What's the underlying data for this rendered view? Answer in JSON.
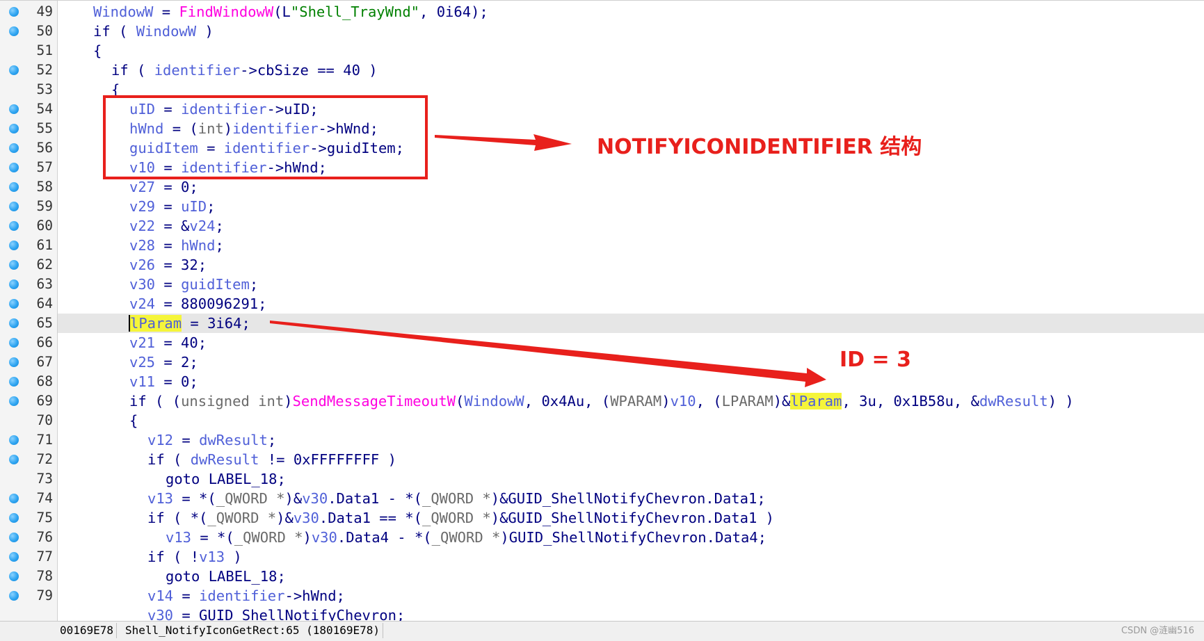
{
  "editor": {
    "lines": [
      {
        "n": "49",
        "bp": true,
        "indent": 0,
        "tokens": [
          [
            "v",
            "WindowW"
          ],
          [
            "k",
            " = "
          ],
          [
            "f",
            "FindWindowW"
          ],
          [
            "k",
            "(L"
          ],
          [
            "s",
            "\"Shell_TrayWnd\""
          ],
          [
            "k",
            ", 0i64);"
          ]
        ]
      },
      {
        "n": "50",
        "bp": true,
        "indent": 0,
        "tokens": [
          [
            "k",
            "if ( "
          ],
          [
            "v",
            "WindowW"
          ],
          [
            "k",
            " )"
          ]
        ]
      },
      {
        "n": "51",
        "bp": false,
        "indent": 0,
        "tokens": [
          [
            "k",
            "{"
          ]
        ]
      },
      {
        "n": "52",
        "bp": true,
        "indent": 1,
        "tokens": [
          [
            "k",
            "if ( "
          ],
          [
            "v",
            "identifier"
          ],
          [
            "k",
            "->cbSize == 40 )"
          ]
        ]
      },
      {
        "n": "53",
        "bp": false,
        "indent": 1,
        "tokens": [
          [
            "k",
            "{"
          ]
        ]
      },
      {
        "n": "54",
        "bp": true,
        "indent": 2,
        "tokens": [
          [
            "v",
            "uID"
          ],
          [
            "k",
            " = "
          ],
          [
            "v",
            "identifier"
          ],
          [
            "k",
            "->uID;"
          ]
        ]
      },
      {
        "n": "55",
        "bp": true,
        "indent": 2,
        "tokens": [
          [
            "v",
            "hWnd"
          ],
          [
            "k",
            " = ("
          ],
          [
            "c",
            "int"
          ],
          [
            "k",
            ")"
          ],
          [
            "v",
            "identifier"
          ],
          [
            "k",
            "->hWnd;"
          ]
        ]
      },
      {
        "n": "56",
        "bp": true,
        "indent": 2,
        "tokens": [
          [
            "v",
            "guidItem"
          ],
          [
            "k",
            " = "
          ],
          [
            "v",
            "identifier"
          ],
          [
            "k",
            "->guidItem;"
          ]
        ]
      },
      {
        "n": "57",
        "bp": true,
        "indent": 2,
        "tokens": [
          [
            "v",
            "v10"
          ],
          [
            "k",
            " = "
          ],
          [
            "v",
            "identifier"
          ],
          [
            "k",
            "->hWnd;"
          ]
        ]
      },
      {
        "n": "58",
        "bp": true,
        "indent": 2,
        "tokens": [
          [
            "v",
            "v27"
          ],
          [
            "k",
            " = 0;"
          ]
        ]
      },
      {
        "n": "59",
        "bp": true,
        "indent": 2,
        "tokens": [
          [
            "v",
            "v29"
          ],
          [
            "k",
            " = "
          ],
          [
            "v",
            "uID"
          ],
          [
            "k",
            ";"
          ]
        ]
      },
      {
        "n": "60",
        "bp": true,
        "indent": 2,
        "tokens": [
          [
            "v",
            "v22"
          ],
          [
            "k",
            " = &"
          ],
          [
            "v",
            "v24"
          ],
          [
            "k",
            ";"
          ]
        ]
      },
      {
        "n": "61",
        "bp": true,
        "indent": 2,
        "tokens": [
          [
            "v",
            "v28"
          ],
          [
            "k",
            " = "
          ],
          [
            "v",
            "hWnd"
          ],
          [
            "k",
            ";"
          ]
        ]
      },
      {
        "n": "62",
        "bp": true,
        "indent": 2,
        "tokens": [
          [
            "v",
            "v26"
          ],
          [
            "k",
            " = 32;"
          ]
        ]
      },
      {
        "n": "63",
        "bp": true,
        "indent": 2,
        "tokens": [
          [
            "v",
            "v30"
          ],
          [
            "k",
            " = "
          ],
          [
            "v",
            "guidItem"
          ],
          [
            "k",
            ";"
          ]
        ]
      },
      {
        "n": "64",
        "bp": true,
        "indent": 2,
        "tokens": [
          [
            "v",
            "v24"
          ],
          [
            "k",
            " = 880096291;"
          ]
        ]
      },
      {
        "n": "65",
        "bp": true,
        "indent": 2,
        "current": true,
        "tokens": [
          [
            "vcur",
            "l"
          ],
          [
            "vhi",
            "Param"
          ],
          [
            "k",
            " = 3i64;"
          ]
        ]
      },
      {
        "n": "66",
        "bp": true,
        "indent": 2,
        "tokens": [
          [
            "v",
            "v21"
          ],
          [
            "k",
            " = 40;"
          ]
        ]
      },
      {
        "n": "67",
        "bp": true,
        "indent": 2,
        "tokens": [
          [
            "v",
            "v25"
          ],
          [
            "k",
            " = 2;"
          ]
        ]
      },
      {
        "n": "68",
        "bp": true,
        "indent": 2,
        "tokens": [
          [
            "v",
            "v11"
          ],
          [
            "k",
            " = 0;"
          ]
        ]
      },
      {
        "n": "69",
        "bp": true,
        "indent": 2,
        "tokens": [
          [
            "k",
            "if ( ("
          ],
          [
            "c",
            "unsigned int"
          ],
          [
            "k",
            ")"
          ],
          [
            "f",
            "SendMessageTimeoutW"
          ],
          [
            "k",
            "("
          ],
          [
            "v",
            "WindowW"
          ],
          [
            "k",
            ", 0x4Au, ("
          ],
          [
            "c",
            "WPARAM"
          ],
          [
            "k",
            ")"
          ],
          [
            "v",
            "v10"
          ],
          [
            "k",
            ", ("
          ],
          [
            "c",
            "LPARAM"
          ],
          [
            "k",
            ")&"
          ],
          [
            "vhi",
            "lParam"
          ],
          [
            "k",
            ", 3u, 0x1B58u, &"
          ],
          [
            "v",
            "dwResult"
          ],
          [
            "k",
            ") )"
          ]
        ]
      },
      {
        "n": "70",
        "bp": false,
        "indent": 2,
        "tokens": [
          [
            "k",
            "{"
          ]
        ]
      },
      {
        "n": "71",
        "bp": true,
        "indent": 3,
        "tokens": [
          [
            "v",
            "v12"
          ],
          [
            "k",
            " = "
          ],
          [
            "v",
            "dwResult"
          ],
          [
            "k",
            ";"
          ]
        ]
      },
      {
        "n": "72",
        "bp": true,
        "indent": 3,
        "tokens": [
          [
            "k",
            "if ( "
          ],
          [
            "v",
            "dwResult"
          ],
          [
            "k",
            " != 0xFFFFFFFF )"
          ]
        ]
      },
      {
        "n": "73",
        "bp": false,
        "indent": 4,
        "tokens": [
          [
            "k",
            "goto LABEL_18;"
          ]
        ]
      },
      {
        "n": "74",
        "bp": true,
        "indent": 3,
        "tokens": [
          [
            "v",
            "v13"
          ],
          [
            "k",
            " = *("
          ],
          [
            "c",
            "_QWORD *"
          ],
          [
            "k",
            ")&"
          ],
          [
            "v",
            "v30"
          ],
          [
            "k",
            ".Data1 - *("
          ],
          [
            "c",
            "_QWORD *"
          ],
          [
            "k",
            ")&GUID_ShellNotifyChevron.Data1;"
          ]
        ]
      },
      {
        "n": "75",
        "bp": true,
        "indent": 3,
        "tokens": [
          [
            "k",
            "if ( *("
          ],
          [
            "c",
            "_QWORD *"
          ],
          [
            "k",
            ")&"
          ],
          [
            "v",
            "v30"
          ],
          [
            "k",
            ".Data1 == *("
          ],
          [
            "c",
            "_QWORD *"
          ],
          [
            "k",
            ")&GUID_ShellNotifyChevron.Data1 )"
          ]
        ]
      },
      {
        "n": "76",
        "bp": true,
        "indent": 4,
        "tokens": [
          [
            "v",
            "v13"
          ],
          [
            "k",
            " = *("
          ],
          [
            "c",
            "_QWORD *"
          ],
          [
            "k",
            ")"
          ],
          [
            "v",
            "v30"
          ],
          [
            "k",
            ".Data4 - *("
          ],
          [
            "c",
            "_QWORD *"
          ],
          [
            "k",
            ")GUID_ShellNotifyChevron.Data4;"
          ]
        ]
      },
      {
        "n": "77",
        "bp": true,
        "indent": 3,
        "tokens": [
          [
            "k",
            "if ( !"
          ],
          [
            "v",
            "v13"
          ],
          [
            "k",
            " )"
          ]
        ]
      },
      {
        "n": "78",
        "bp": true,
        "indent": 4,
        "tokens": [
          [
            "k",
            "goto LABEL_18;"
          ]
        ]
      },
      {
        "n": "79",
        "bp": true,
        "indent": 3,
        "tokens": [
          [
            "v",
            "v14"
          ],
          [
            "k",
            " = "
          ],
          [
            "v",
            "identifier"
          ],
          [
            "k",
            "->hWnd;"
          ]
        ]
      },
      {
        "n": "",
        "bp": false,
        "indent": 3,
        "tokens": [
          [
            "v",
            "v30"
          ],
          [
            "k",
            " = GUID_ShellNotifyChevron;"
          ]
        ]
      }
    ]
  },
  "annotations": {
    "struct_label": "NOTIFYICONIDENTIFIER 结构",
    "id_label": "ID = 3",
    "color": "#e8201c"
  },
  "statusbar": {
    "address": "00169E78",
    "location": "Shell_NotifyIconGetRect:65 (180169E78)"
  },
  "watermark": "CSDN @涟幽516",
  "colors": {
    "keyword": "#000080",
    "variable": "#5060d8",
    "function": "#ff00e0",
    "string": "#008000",
    "type": "#6a6a6a",
    "highlight": "#f5f53a",
    "breakpoint": "#2ea4f0"
  }
}
